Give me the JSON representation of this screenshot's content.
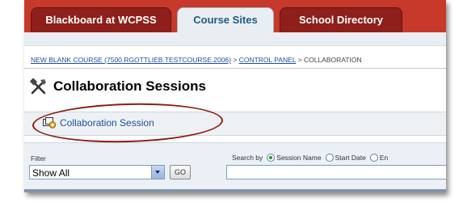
{
  "tabs": [
    {
      "label": "Blackboard at WCPSS",
      "active": false
    },
    {
      "label": "Course Sites",
      "active": true
    },
    {
      "label": "School Directory",
      "active": false
    }
  ],
  "breadcrumb": {
    "course": "NEW BLANK COURSE (7500.RGOTTLIEB.TESTCOURSE.2006)",
    "separator": ">",
    "control_panel": "CONTROL PANEL",
    "current": "COLLABORATION"
  },
  "page": {
    "title": "Collaboration Sessions",
    "title_icon": "tools-icon"
  },
  "action": {
    "label": "Collaboration Session",
    "icon": "add-session-icon"
  },
  "filter": {
    "label": "Filter",
    "selected": "Show All",
    "go_label": "GO"
  },
  "search": {
    "label": "Search by",
    "options": [
      "Session Name",
      "Start Date",
      "En"
    ],
    "selected": "Session Name",
    "value": ""
  },
  "colors": {
    "tab_bar": "#c6392b",
    "tab_dark": "#8e1f1a",
    "link": "#1d4fa0",
    "annotation": "#8b1d15"
  }
}
